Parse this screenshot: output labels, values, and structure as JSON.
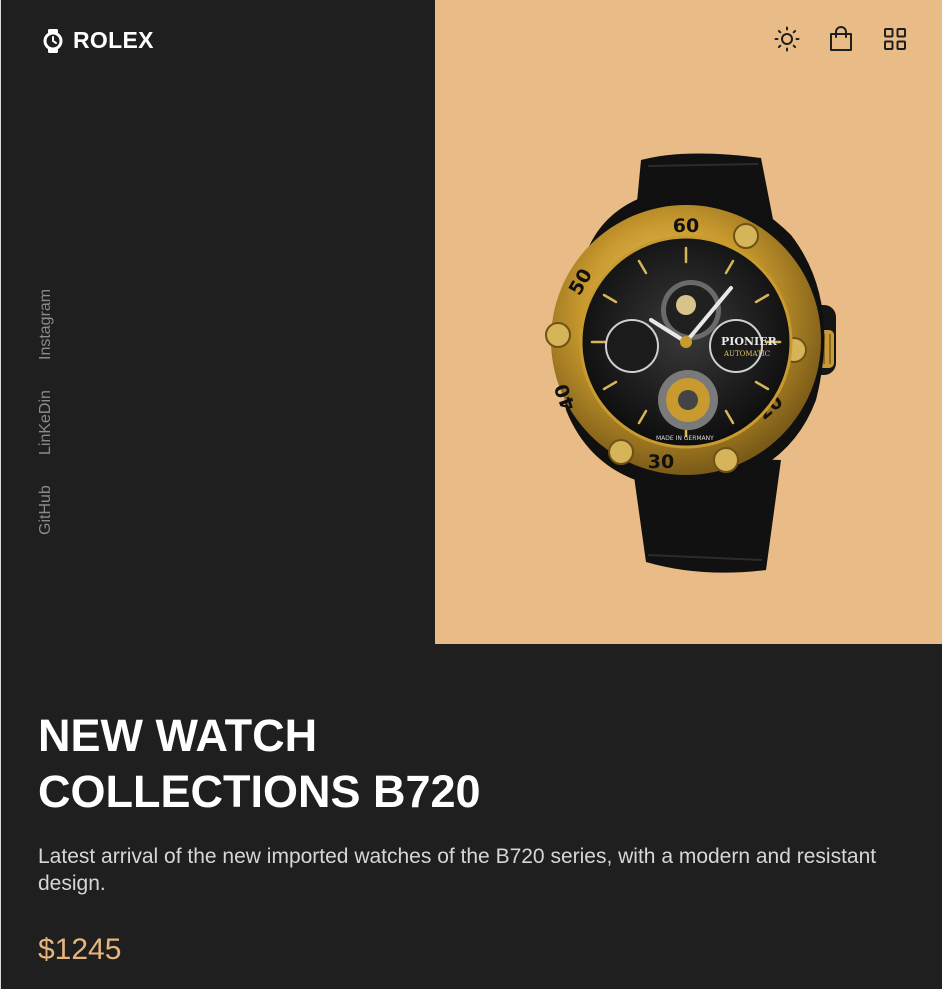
{
  "brand": {
    "name": "ROLEX",
    "icon": "watch-icon"
  },
  "header": {
    "actions": [
      {
        "name": "theme-toggle-button",
        "icon": "sun-icon"
      },
      {
        "name": "cart-button",
        "icon": "shopping-bag-icon"
      },
      {
        "name": "menu-button",
        "icon": "grid-icon"
      }
    ]
  },
  "social": {
    "links": [
      "Instagram",
      "LinKeDin",
      "GitHub"
    ]
  },
  "hero": {
    "title_line1": "NEW WATCH",
    "title_line2": "COLLECTIONS B720",
    "description": "Latest arrival of the new imported watches of the B720 series, with a modern and resistant design.",
    "price": "$1245",
    "image_alt": "watch-image",
    "watch_brand": "PIONIER",
    "watch_subtitle": "AUTOMATIC",
    "watch_origin": "MADE IN GERMANY",
    "bezel_numbers": [
      "60",
      "50",
      "40",
      "30",
      "20"
    ]
  },
  "colors": {
    "background": "#1f1f1f",
    "hero_panel": "#e8bb87",
    "accent": "#e7b47e",
    "text": "#ffffff",
    "muted": "#8b8b8b"
  }
}
